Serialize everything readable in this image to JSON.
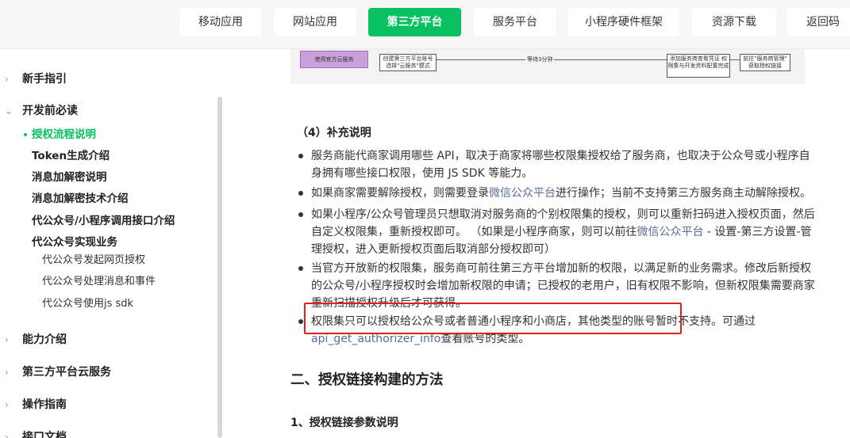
{
  "topnav": {
    "items": [
      "移动应用",
      "网站应用",
      "第三方平台",
      "服务平台",
      "小程序硬件框架",
      "资源下载",
      "返回码"
    ],
    "active_index": 2,
    "accent_color": "#07c160"
  },
  "sidebar": {
    "sections": [
      {
        "label": "新手指引",
        "expanded": false
      },
      {
        "label": "开发前必读",
        "expanded": true
      },
      {
        "label": "能力介绍",
        "expanded": false
      },
      {
        "label": "第三方平台云服务",
        "expanded": false
      },
      {
        "label": "操作指南",
        "expanded": false
      },
      {
        "label": "接口文档",
        "expanded": false
      }
    ],
    "items": [
      {
        "label": "授权流程说明",
        "active": true
      },
      {
        "label": "Token生成介绍"
      },
      {
        "label": "消息加解密说明"
      },
      {
        "label": "消息加解密技术介绍"
      },
      {
        "label": "代公众号/小程序调用接口介绍"
      },
      {
        "label": "代公众号实现业务"
      }
    ],
    "subitems": [
      "代公众号发起网页授权",
      "代公众号处理消息和事件",
      "代公众号使用js sdk"
    ]
  },
  "flow": {
    "start_box": "使用官方云服务",
    "box1": "创建第三方平台账号 选择\"云服务\"模式",
    "middle": "等待3分钟",
    "box2": "添加服务商查看凭证 权限集与开发资料配置完成",
    "box3": "前往\"服务商管理\" 获取授权链接"
  },
  "content": {
    "section_title": "（4）补充说明",
    "bullets": [
      {
        "text": "服务商能代商家调用哪些 API，取决于商家将哪些权限集授权给了服务商，也取决于公众号或小程序自身拥有哪些接口权限，使用 JS SDK 等能力。"
      },
      {
        "pre": "如果商家需要解除授权，则需要登录",
        "link": "微信公众平台",
        "post": "进行操作；当前不支持第三方服务商主动解除授权。"
      },
      {
        "pre": "如果小程序/公众号管理员只想取消对服务商的个别权限集的授权，则可以重新扫码进入授权页面，然后自定义权限集，重新授权即可。 （如果是小程序商家，则可以前往",
        "link": "微信公众平台",
        "post": " - 设置-第三方设置-管理授权，进入更新授权页面后取消部分授权即可）"
      },
      {
        "text": "当官方开放新的权限集，服务商可前往第三方平台增加新的权限，以满足新的业务需求。修改后新授权的公众号/小程序授权时会增加新权限的申请；已授权的老用户，旧有权限不影响，但新权限集需要商家重新扫描授权升级后才可获得。"
      },
      {
        "pre": "权限集只可以授权给公众号或者普通小程序和小商店，其他类型的账号暂时不支持。可通过",
        "link": "api_get_authorizer_info",
        "post": "查看账号的类型。"
      }
    ],
    "heading2": "二、授权链接构建的方法",
    "heading3": "1、授权链接参数说明"
  },
  "colors": {
    "highlight_border": "#e02020",
    "link": "#576b95"
  }
}
